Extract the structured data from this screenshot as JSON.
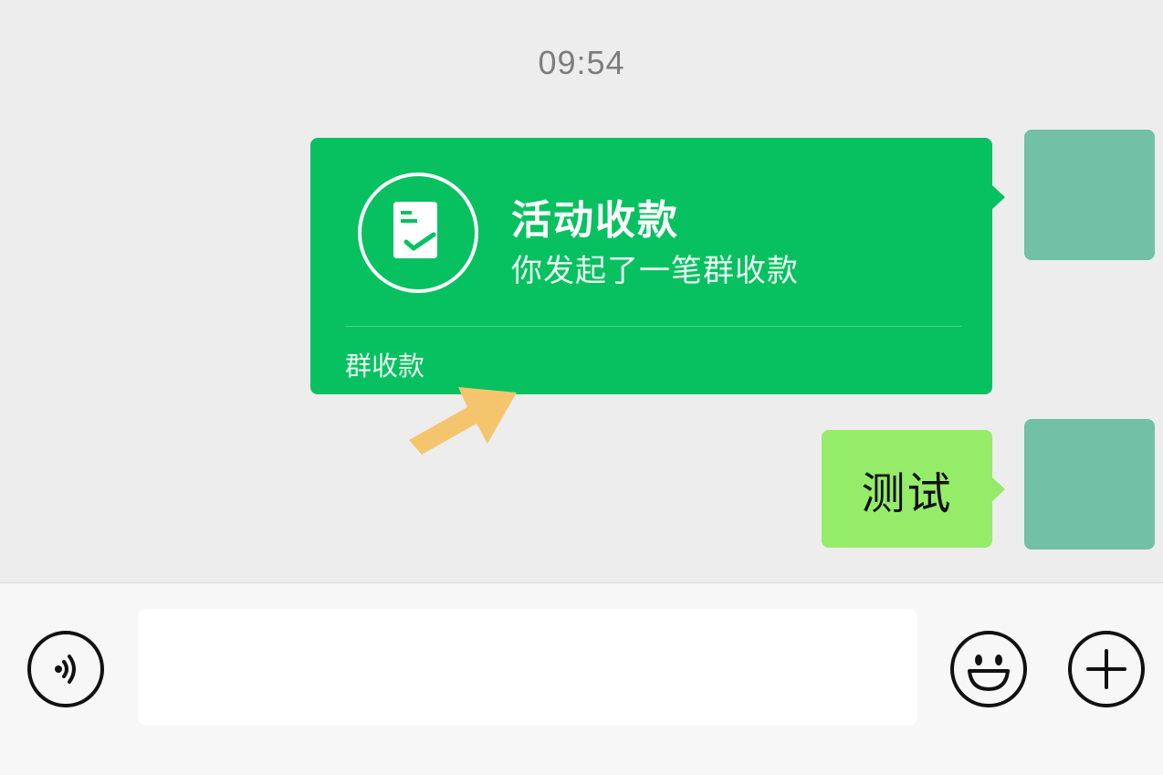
{
  "chat": {
    "timestamp": "09:54",
    "payment_card": {
      "title": "活动收款",
      "subtitle": "你发起了一笔群收款",
      "footer": "群收款",
      "icon": "receipt-check-icon"
    },
    "text_message": "测试"
  },
  "input_bar": {
    "text_value": "",
    "voice_icon": "voice-icon",
    "emoji_icon": "emoji-icon",
    "plus_icon": "plus-icon"
  },
  "colors": {
    "chat_background": "#ededed",
    "payment_card": "#07c160",
    "text_bubble": "#95ec69",
    "avatar": "#72c0a6",
    "arrow_annotation": "#f5c56e"
  }
}
